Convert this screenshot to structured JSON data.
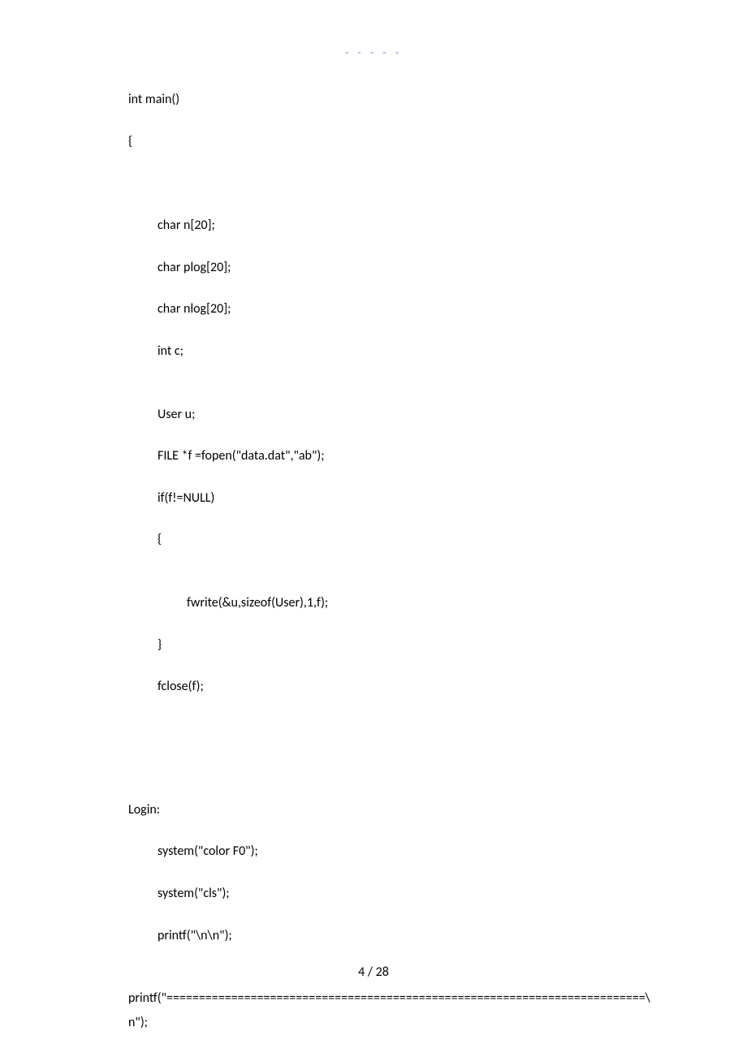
{
  "header": {
    "dashes": "- - - - -"
  },
  "code": {
    "line1": "int main()",
    "line2": "{",
    "line3": "char n[20];",
    "line4": "char plog[20];",
    "line5": "char nlog[20];",
    "line6": "int c;",
    "line7": "User u;",
    "line8": "FILE *f =fopen(\"data.dat\",\"ab\");",
    "line9": "if(f!=NULL)",
    "line10": "{",
    "line11": "fwrite(&u,sizeof(User),1,f);",
    "line12": "}",
    "line13": "fclose(f);",
    "line14": "Login:",
    "line15": "system(\"color F0\");",
    "line16": "system(\"cls\");",
    "line17": "printf(\"\\n\\n\");",
    "line18": "printf(\"==========================================================================\\",
    "line19": "n\");"
  },
  "footer": {
    "pageNumber": "4 / 28"
  }
}
